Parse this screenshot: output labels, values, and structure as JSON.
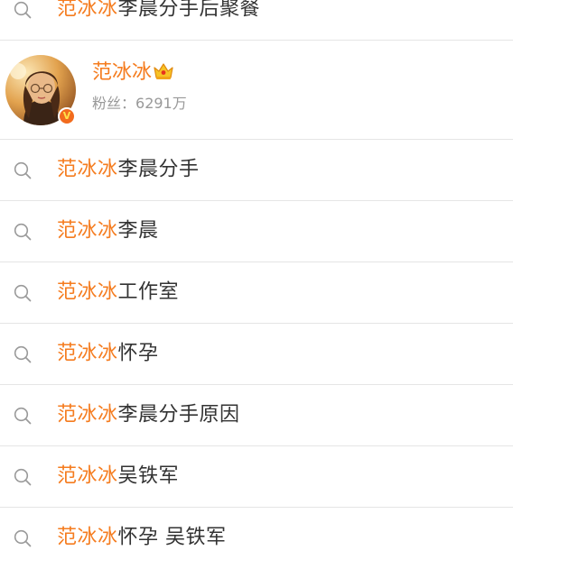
{
  "highlight_color": "#f57c1f",
  "top_suggestion": {
    "highlight": "范冰冰",
    "rest": "李晨分手后聚餐"
  },
  "user_card": {
    "name": "范冰冰",
    "badge_icon": "crown-icon",
    "verified_icon": "verified-v-icon",
    "verified_letter": "V",
    "fans_label": "粉丝：",
    "fans_count": "6291万"
  },
  "suggestions": [
    {
      "highlight": "范冰冰",
      "rest": "李晨分手"
    },
    {
      "highlight": "范冰冰",
      "rest": "李晨"
    },
    {
      "highlight": "范冰冰",
      "rest": "工作室"
    },
    {
      "highlight": "范冰冰",
      "rest": "怀孕"
    },
    {
      "highlight": "范冰冰",
      "rest": "李晨分手原因"
    },
    {
      "highlight": "范冰冰",
      "rest": "吴铁军"
    },
    {
      "highlight": "范冰冰",
      "rest": "怀孕 吴铁军"
    }
  ]
}
